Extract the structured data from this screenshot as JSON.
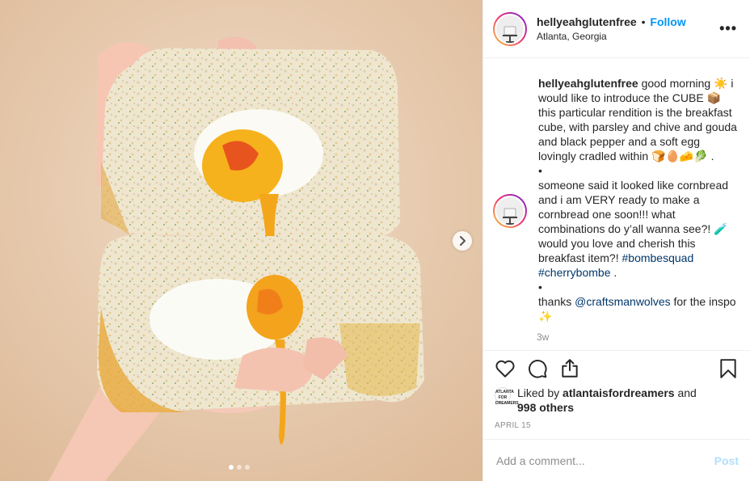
{
  "header": {
    "username": "hellyeahglutenfree",
    "separator": "•",
    "follow_label": "Follow",
    "location": "Atlanta, Georgia",
    "more_label": "•••"
  },
  "caption": {
    "username": "hellyeahglutenfree",
    "part1": " good morning ☀️ i would like to introduce the CUBE 📦 this particular rendition is the breakfast cube, with parsley and chive and gouda and black pepper and a soft egg lovingly cradled within 🍞🥚🧀🥬 .",
    "bullet": "•",
    "part2": "someone said it looked like cornbread and i am VERY ready to make a cornbread one soon!!! what combinations do y’all wanna see?! 🧪 would you love and cherish this breakfast item?! ",
    "hashtag1": "#bombesquad",
    "hashtag2": "#cherrybombe",
    "part2_end": " .",
    "part3": "thanks ",
    "mention": "@craftsmanwolves",
    "part3_end": " for the inspo ✨",
    "time": "3w"
  },
  "likes": {
    "mini_avatar_text": "ATLANTA FOR DREAMERS",
    "prefix": "Liked by ",
    "liker": "atlantaisfordreamers",
    "middle": " and",
    "others": "998 others"
  },
  "date": "APRIL 15",
  "comment": {
    "placeholder": "Add a comment...",
    "post_label": "Post"
  },
  "carousel": {
    "slides": 3,
    "active": 1
  },
  "colors": {
    "link": "#00376b",
    "follow": "#0095f6",
    "post_disabled": "#b2dffc",
    "muted": "#8e8e8e"
  },
  "icons": [
    "heart-icon",
    "comment-icon",
    "share-icon",
    "bookmark-icon",
    "chevron-right-icon",
    "more-icon"
  ]
}
